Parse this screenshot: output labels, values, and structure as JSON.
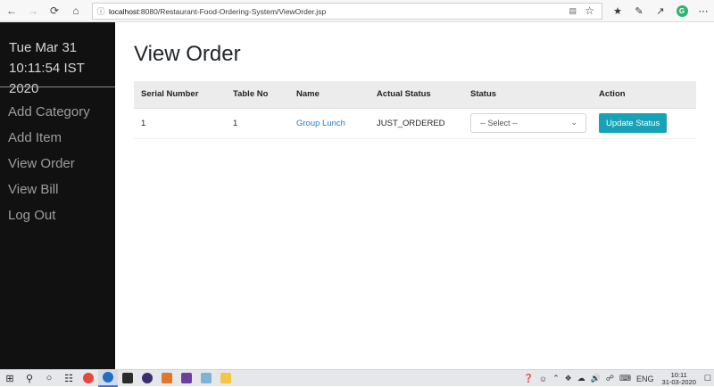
{
  "browser": {
    "url_host": "localhost",
    "url_path": ":8080/Restaurant-Food-Ordering-System/ViewOrder.jsp"
  },
  "sidebar": {
    "date_line": "Tue Mar 31",
    "time_line": "10:11:54 IST 2020",
    "items": [
      {
        "label": "Add Category"
      },
      {
        "label": "Add Item"
      },
      {
        "label": "View Order"
      },
      {
        "label": "View Bill"
      },
      {
        "label": "Log Out"
      }
    ]
  },
  "main": {
    "title": "View Order",
    "table": {
      "headers": [
        "Serial Number",
        "Table No",
        "Name",
        "Actual Status",
        "Status",
        "Action"
      ],
      "rows": [
        {
          "serial": "1",
          "table_no": "1",
          "name": "Group Lunch",
          "actual_status": "JUST_ORDERED",
          "status_select": "-- Select --",
          "action_label": "Update Status"
        }
      ]
    }
  },
  "taskbar": {
    "lang": "ENG",
    "time": "10:11",
    "date": "31-03-2020"
  },
  "colors": {
    "sidebar_bg": "#111111",
    "accent_button": "#17a2b8",
    "link": "#2e7dbb"
  }
}
